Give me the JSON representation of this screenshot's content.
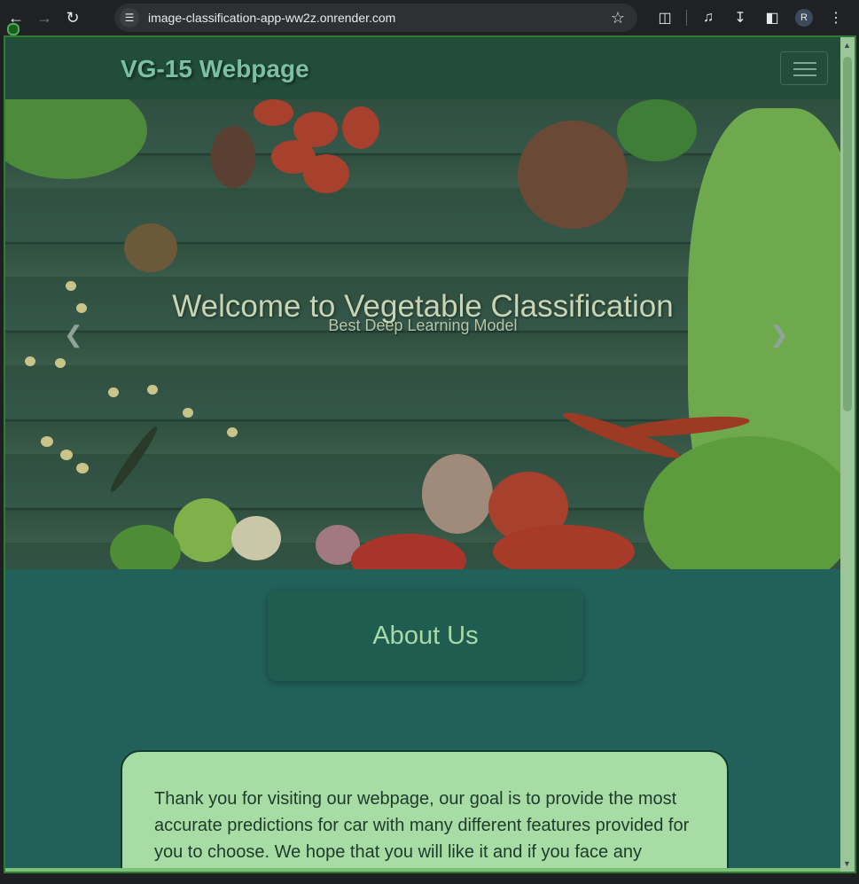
{
  "browser": {
    "url": "image-classification-app-ww2z.onrender.com",
    "profile_initial": "R"
  },
  "navbar": {
    "brand": "VG-15 Webpage"
  },
  "hero": {
    "title": "Welcome to Vegetable Classification",
    "subtitle": "Best Deep Learning Model"
  },
  "about": {
    "title": "About Us",
    "text": "Thank you for visiting our webpage, our goal is to provide the most accurate predictions for car with many different features provided for you to choose. We hope that you will like it and if you face any"
  },
  "icons": {
    "back": "arrow-left-icon",
    "forward": "arrow-right-icon",
    "reload": "reload-icon",
    "site_info": "site-info-icon",
    "bookmark": "star-icon",
    "extensions": "puzzle-icon",
    "media": "media-list-icon",
    "downloads": "download-icon",
    "side_panel": "side-panel-icon",
    "menu": "kebab-menu-icon",
    "hamburger": "hamburger-icon"
  },
  "colors": {
    "navbar_bg": "#224d3b",
    "page_bg": "#22615a",
    "info_box_bg": "#a8dca5",
    "brand_text": "#7bbfa6"
  }
}
